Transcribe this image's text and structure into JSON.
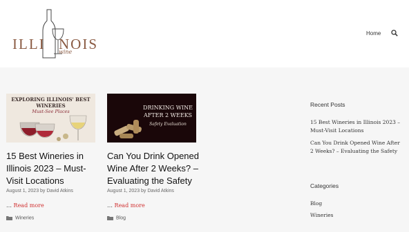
{
  "site": {
    "logo_left": "ILLI",
    "logo_right": "NOIS",
    "logo_sub": "wine"
  },
  "nav": {
    "home": "Home",
    "search_icon": "search-icon"
  },
  "posts": [
    {
      "image_caption_line1": "EXPLORING ILLINOIS' BEST",
      "image_caption_line2": "WINERIES",
      "image_caption_line3": "Must-See Places",
      "title": "15 Best Wineries in Illinois 2023 – Must-Visit Locations",
      "meta": "August 1, 2023 by David Atkins",
      "read_more_prefix": "…",
      "read_more": "Read more",
      "category": "Wineries"
    },
    {
      "image_caption_line1": "DRINKING WINE",
      "image_caption_line2": "AFTER 2 WEEKS",
      "image_caption_line3": "Safety Evaluation",
      "title": "Can You Drink Opened Wine After 2 Weeks? – Evaluating the Safety",
      "meta": "August 1, 2023 by David Atkins",
      "read_more_prefix": "…",
      "read_more": "Read more",
      "category": "Blog"
    }
  ],
  "sidebar": {
    "recent_heading": "Recent Posts",
    "recent": [
      "15 Best Wineries in Illinois 2023 – Must-Visit Locations",
      "Can You Drink Opened Wine After 2 Weeks? – Evaluating the Safety"
    ],
    "categories_heading": "Categories",
    "categories": [
      "Blog",
      "Wineries"
    ]
  },
  "colors": {
    "accent_link": "#d03030",
    "logo_brown": "#8a5a42",
    "page_bg": "#f6f6f6"
  }
}
